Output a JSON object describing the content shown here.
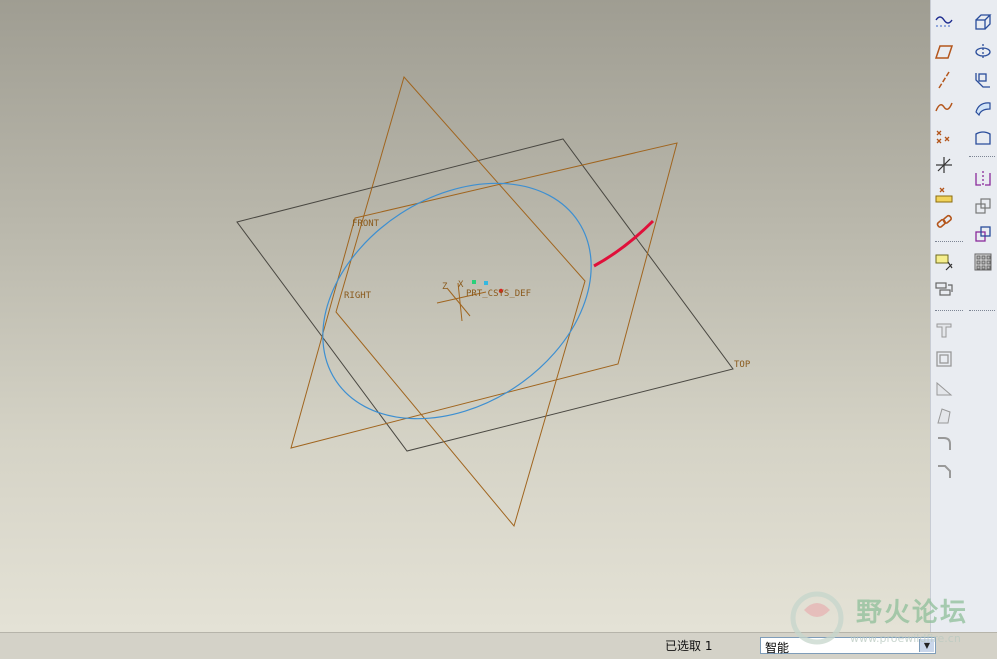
{
  "viewport": {
    "datum_labels": {
      "front": "FRONT",
      "right": "RIGHT",
      "top": "TOP",
      "csys": "PRT_CSYS_DEF",
      "csys_axis_x": "X",
      "csys_axis_z": "Z"
    },
    "colors": {
      "datum_plane": "#a0651f",
      "datum_plane_top": "#4a4842",
      "sketch_curve": "#3d8fd1",
      "highlight_curve": "#e0103a"
    }
  },
  "toolbar": {
    "left_column": [
      "datum-curve-sketch-icon",
      "datum-plane-icon",
      "datum-axis-icon",
      "datum-curve-icon",
      "datum-point-icon",
      "coordinate-system-icon",
      "analysis-feature-icon",
      "chain-link-icon",
      "annotation-icon",
      "view-manager-icon"
    ],
    "right_column": [
      "extrude-icon",
      "revolve-icon",
      "sweep-icon",
      "blend-icon",
      "boundary-icon",
      "mirror-icon",
      "copy-icon",
      "merge-icon",
      "pattern-icon",
      "hole-icon",
      "shell-icon",
      "rib-icon",
      "draft-icon",
      "round-icon",
      "chamfer-icon"
    ]
  },
  "statusbar": {
    "selected_text": "已选取 1",
    "filter_value": "智能"
  },
  "watermark": {
    "title": "野火论坛",
    "url": "www.proewildfire.cn"
  }
}
